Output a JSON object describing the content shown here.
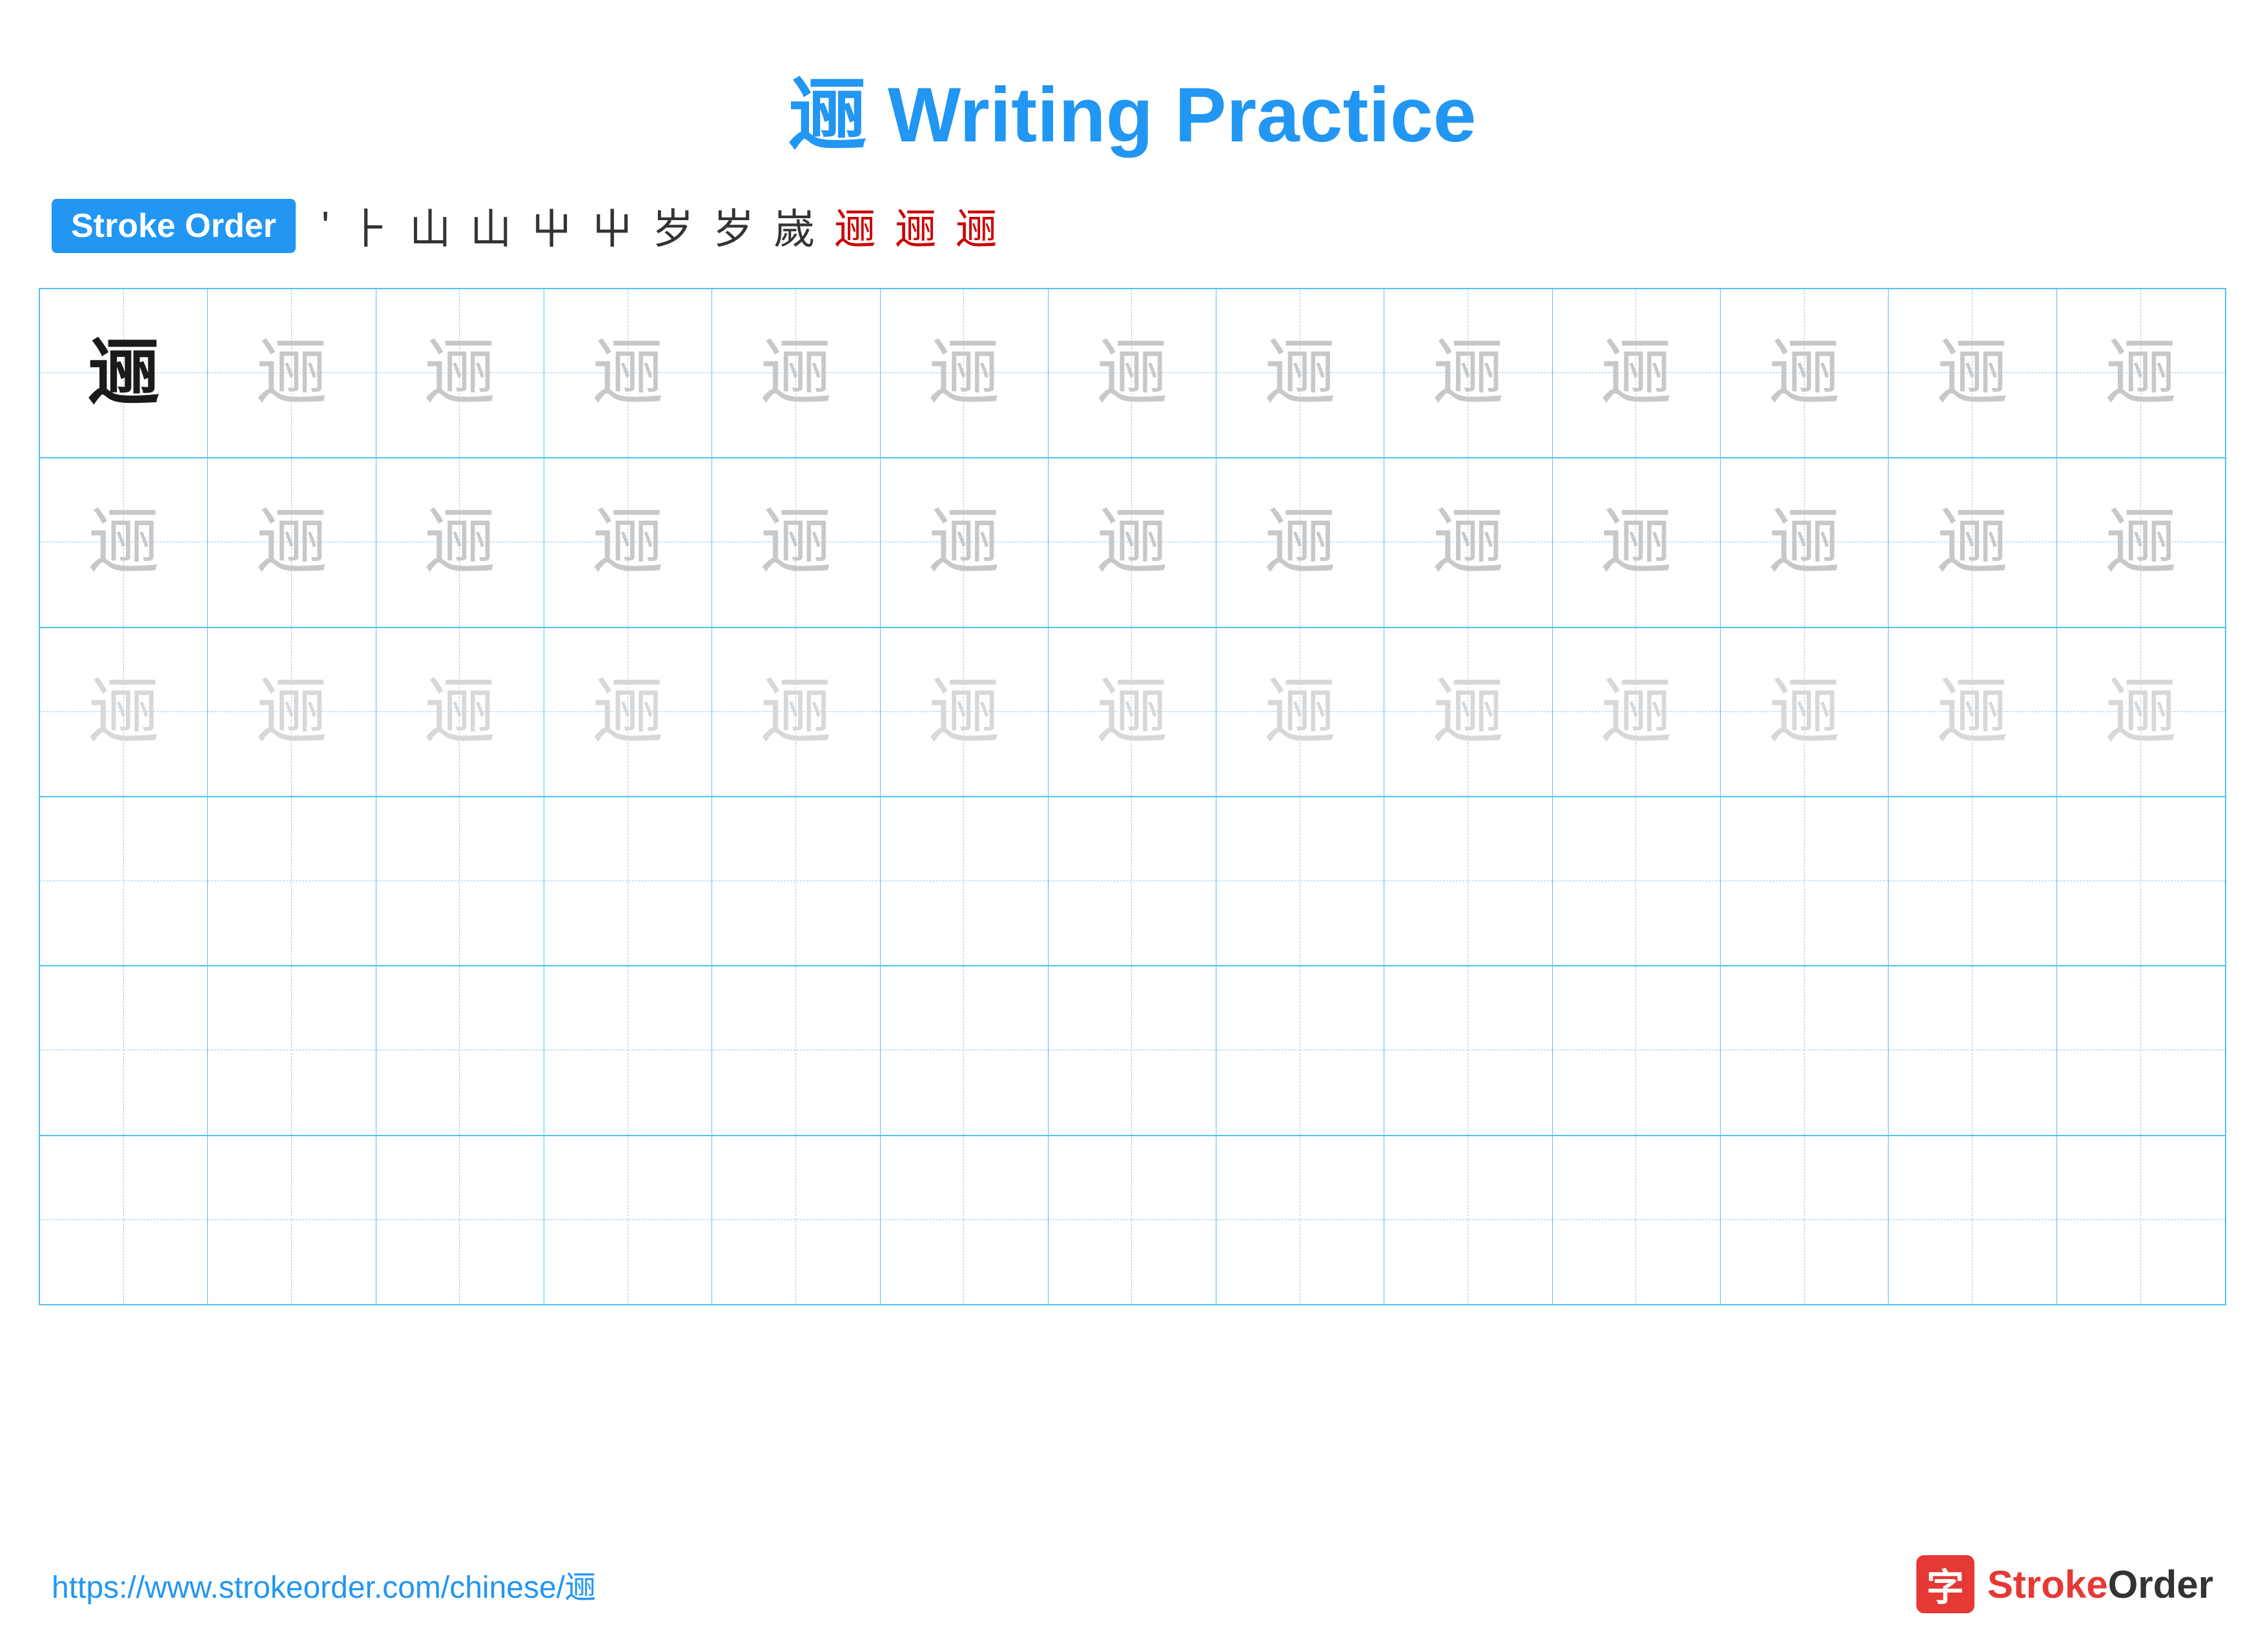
{
  "page": {
    "title_char": "逦",
    "title_text": " Writing Practice",
    "stroke_order_label": "Stroke Order",
    "stroke_steps": [
      "'",
      "⺊",
      "山",
      "山",
      "屮",
      "屮",
      "岁",
      "岁",
      "嵗",
      "逦",
      "逦",
      "逦"
    ],
    "stroke_steps_last_count": 4,
    "character": "逦",
    "rows": [
      {
        "type": "practice",
        "cells": [
          {
            "shade": "dark"
          },
          {
            "shade": "light"
          },
          {
            "shade": "light"
          },
          {
            "shade": "light"
          },
          {
            "shade": "light"
          },
          {
            "shade": "light"
          },
          {
            "shade": "light"
          },
          {
            "shade": "light"
          },
          {
            "shade": "light"
          },
          {
            "shade": "light"
          },
          {
            "shade": "light"
          },
          {
            "shade": "light"
          },
          {
            "shade": "light"
          }
        ]
      },
      {
        "type": "practice",
        "cells": [
          {
            "shade": "light"
          },
          {
            "shade": "light"
          },
          {
            "shade": "light"
          },
          {
            "shade": "light"
          },
          {
            "shade": "light"
          },
          {
            "shade": "light"
          },
          {
            "shade": "light"
          },
          {
            "shade": "light"
          },
          {
            "shade": "light"
          },
          {
            "shade": "light"
          },
          {
            "shade": "light"
          },
          {
            "shade": "light"
          },
          {
            "shade": "light"
          }
        ]
      },
      {
        "type": "practice",
        "cells": [
          {
            "shade": "lighter"
          },
          {
            "shade": "lighter"
          },
          {
            "shade": "lighter"
          },
          {
            "shade": "lighter"
          },
          {
            "shade": "lighter"
          },
          {
            "shade": "lighter"
          },
          {
            "shade": "lighter"
          },
          {
            "shade": "lighter"
          },
          {
            "shade": "lighter"
          },
          {
            "shade": "lighter"
          },
          {
            "shade": "lighter"
          },
          {
            "shade": "lighter"
          },
          {
            "shade": "lighter"
          }
        ]
      },
      {
        "type": "empty"
      },
      {
        "type": "empty"
      },
      {
        "type": "empty"
      }
    ],
    "footer": {
      "url": "https://www.strokeorder.com/chinese/逦",
      "logo_text": "StrokeOrder"
    }
  }
}
